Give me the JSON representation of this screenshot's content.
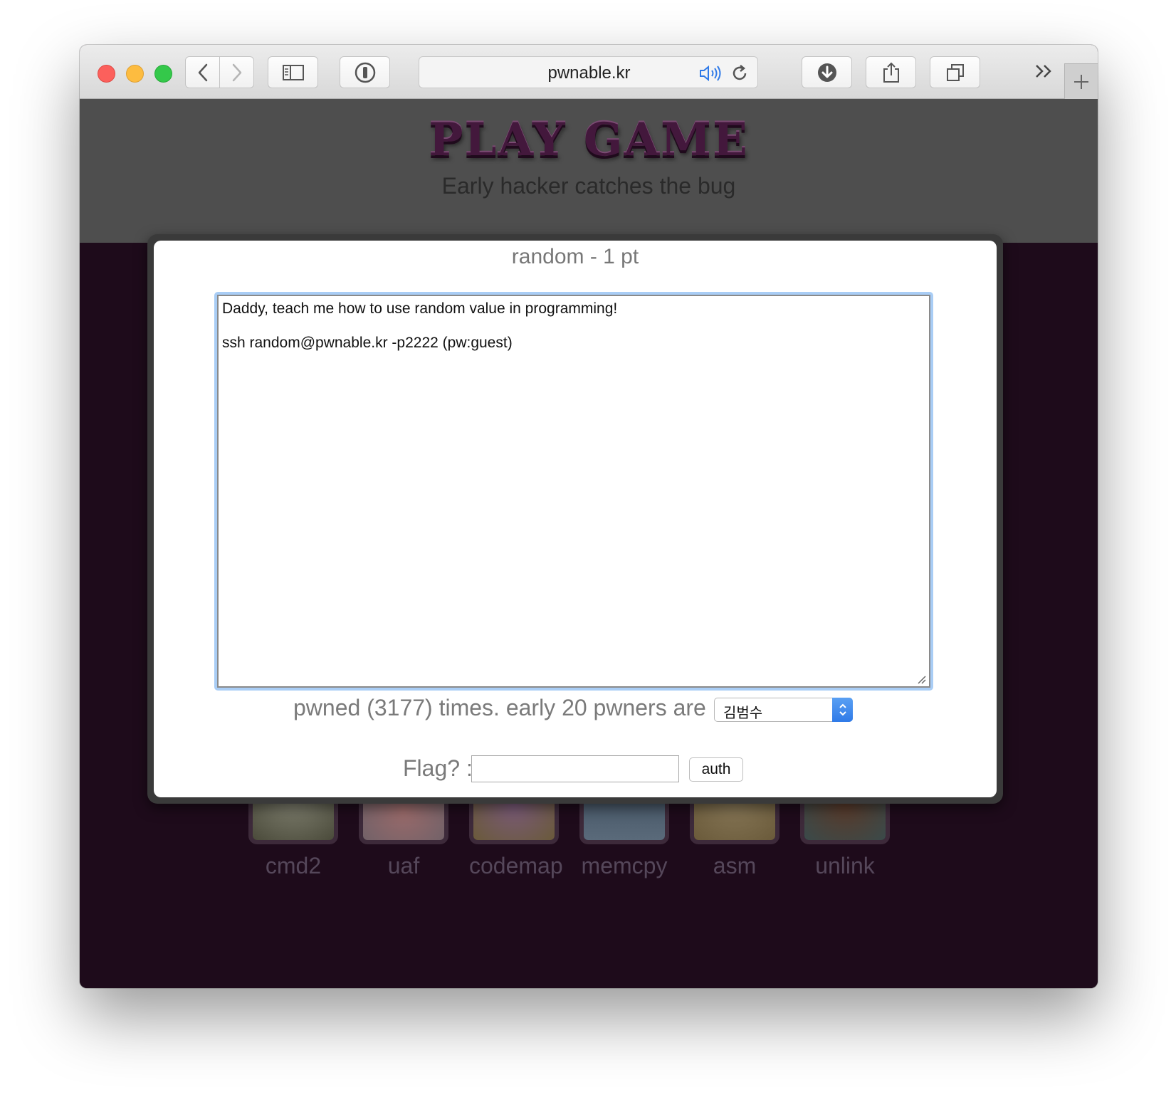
{
  "browser": {
    "url": "pwnable.kr",
    "icons": [
      "back-icon",
      "forward-icon",
      "sidebar-icon",
      "password-manager-icon",
      "audio-icon",
      "reload-icon",
      "download-icon",
      "share-icon",
      "tabs-icon",
      "overflow-icon",
      "new-tab-icon"
    ]
  },
  "header": {
    "title": "PLAY GAME",
    "tagline": "Early hacker catches the bug"
  },
  "modal": {
    "title": "random - 1 pt",
    "description": "Daddy, teach me how to use random value in programming!\n\nssh random@pwnable.kr -p2222 (pw:guest)",
    "pwned_text": "pwned (3177) times. early 20 pwners are :",
    "pwner_selected": "김범수",
    "flag_label": "Flag? :",
    "flag_value": "",
    "auth_label": "auth"
  },
  "challenges": [
    {
      "name": "cmd2",
      "thumb_color": "#6a6a5a"
    },
    {
      "name": "uaf",
      "thumb_color": "#8a7a7a"
    },
    {
      "name": "codemap",
      "thumb_color": "#7a6a5a"
    },
    {
      "name": "memcpy",
      "thumb_color": "#4a5a6a"
    },
    {
      "name": "asm",
      "thumb_color": "#7a6a4a"
    },
    {
      "name": "unlink",
      "thumb_color": "#5a4a3a"
    }
  ],
  "colors": {
    "accent": "#2f7ae8",
    "header_bg": "#4e4e4e",
    "page_bg": "#1e0b1b",
    "logo": "#43183c"
  }
}
